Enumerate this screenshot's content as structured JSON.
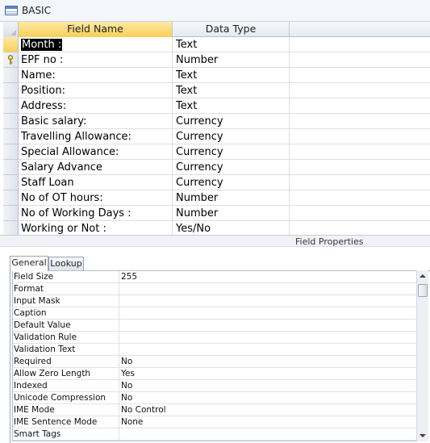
{
  "window": {
    "title": "BASIC",
    "icon": "table-icon"
  },
  "grid": {
    "headers": {
      "field_name": "Field Name",
      "data_type": "Data Type",
      "description": ""
    },
    "rows": [
      {
        "field": "Month :",
        "type": "Text",
        "current": true
      },
      {
        "field": "EPF no :",
        "type": "Number",
        "primary_key": true
      },
      {
        "field": "Name:",
        "type": "Text"
      },
      {
        "field": "Position:",
        "type": "Text"
      },
      {
        "field": "Address:",
        "type": "Text"
      },
      {
        "field": "Basic salary:",
        "type": "Currency"
      },
      {
        "field": "Travelling Allowance:",
        "type": "Currency"
      },
      {
        "field": "Special Allowance:",
        "type": "Currency"
      },
      {
        "field": "Salary Advance",
        "type": "Currency"
      },
      {
        "field": "Staff Loan",
        "type": "Currency"
      },
      {
        "field": "No of OT hours:",
        "type": "Number"
      },
      {
        "field": "No of Working Days :",
        "type": "Number"
      },
      {
        "field": "Working or Not :",
        "type": "Yes/No"
      }
    ]
  },
  "field_properties": {
    "label": "Field Properties",
    "tabs": [
      {
        "label": "General",
        "active": true
      },
      {
        "label": "Lookup",
        "active": false
      }
    ],
    "properties": [
      {
        "label": "Field Size",
        "value": "255"
      },
      {
        "label": "Format",
        "value": ""
      },
      {
        "label": "Input Mask",
        "value": ""
      },
      {
        "label": "Caption",
        "value": ""
      },
      {
        "label": "Default Value",
        "value": ""
      },
      {
        "label": "Validation Rule",
        "value": ""
      },
      {
        "label": "Validation Text",
        "value": ""
      },
      {
        "label": "Required",
        "value": "No"
      },
      {
        "label": "Allow Zero Length",
        "value": "Yes"
      },
      {
        "label": "Indexed",
        "value": "No"
      },
      {
        "label": "Unicode Compression",
        "value": "No"
      },
      {
        "label": "IME Mode",
        "value": "No Control"
      },
      {
        "label": "IME Sentence Mode",
        "value": "None"
      },
      {
        "label": "Smart Tags",
        "value": ""
      }
    ]
  },
  "colors": {
    "header_highlight": "#f9cf57",
    "selection": "#000000"
  }
}
